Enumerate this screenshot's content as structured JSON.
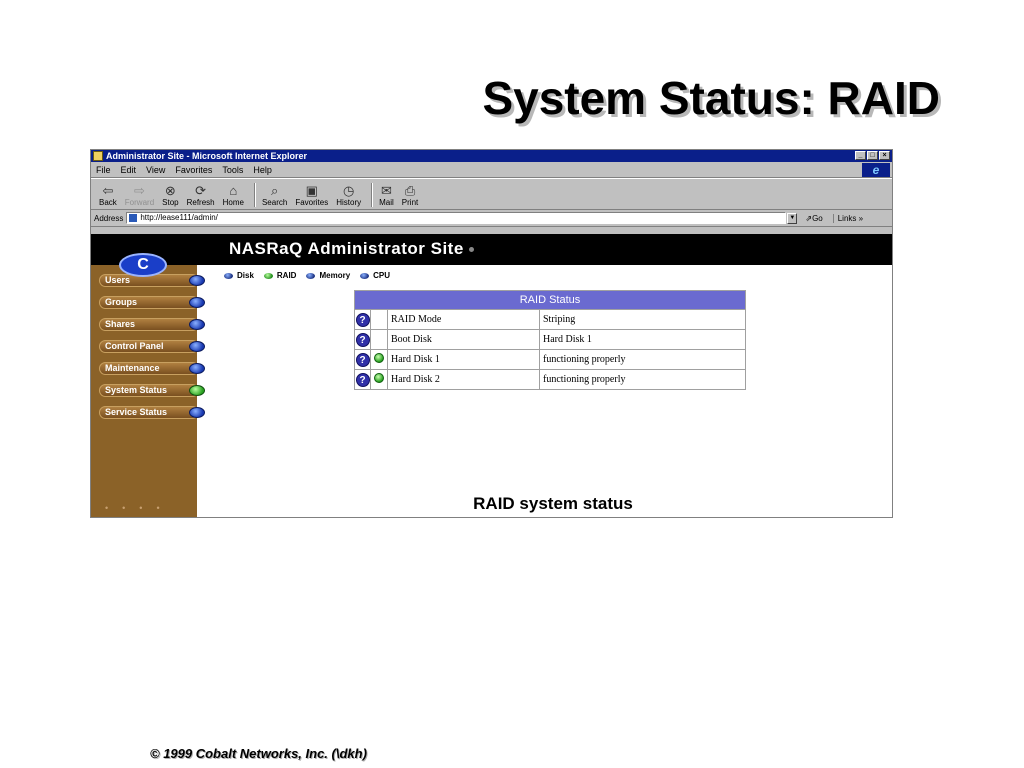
{
  "slide": {
    "title": "System Status: RAID",
    "caption": "RAID system status",
    "footer": "© 1999 Cobalt Networks, Inc. (\\dkh)"
  },
  "browser": {
    "window_title": "Administrator Site - Microsoft Internet Explorer",
    "menu": [
      "File",
      "Edit",
      "View",
      "Favorites",
      "Tools",
      "Help"
    ],
    "toolbar": [
      {
        "label": "Back",
        "icon": "back-arrow-icon",
        "glyph": "⇦"
      },
      {
        "label": "Forward",
        "icon": "forward-arrow-icon",
        "glyph": "⇨"
      },
      {
        "label": "Stop",
        "icon": "stop-icon",
        "glyph": "⊗"
      },
      {
        "label": "Refresh",
        "icon": "refresh-icon",
        "glyph": "⟳"
      },
      {
        "label": "Home",
        "icon": "home-icon",
        "glyph": "⌂"
      },
      {
        "label": "Search",
        "icon": "search-icon",
        "glyph": "⌕"
      },
      {
        "label": "Favorites",
        "icon": "favorites-icon",
        "glyph": "▣"
      },
      {
        "label": "History",
        "icon": "history-icon",
        "glyph": "◷"
      },
      {
        "label": "Mail",
        "icon": "mail-icon",
        "glyph": "✉"
      },
      {
        "label": "Print",
        "icon": "print-icon",
        "glyph": "⎙"
      }
    ],
    "address_label": "Address",
    "address_value": "http://lease111/admin/",
    "go_label": "Go",
    "links_label": "Links »"
  },
  "site": {
    "title": "NASRaQ Administrator Site",
    "logo_letter": "C",
    "subnav": [
      {
        "label": "Disk",
        "led": "blue"
      },
      {
        "label": "RAID",
        "led": "green"
      },
      {
        "label": "Memory",
        "led": "blue"
      },
      {
        "label": "CPU",
        "led": "blue"
      }
    ],
    "sidebar": [
      {
        "label": "Users",
        "led": "blue"
      },
      {
        "label": "Groups",
        "led": "blue"
      },
      {
        "label": "Shares",
        "led": "blue"
      },
      {
        "label": "Control Panel",
        "led": "blue"
      },
      {
        "label": "Maintenance",
        "led": "blue"
      },
      {
        "label": "System Status",
        "led": "green"
      },
      {
        "label": "Service Status",
        "led": "blue"
      }
    ]
  },
  "raid_table": {
    "header": "RAID Status",
    "rows": [
      {
        "name": "RAID Mode",
        "value": "Striping",
        "status_led": false
      },
      {
        "name": "Boot Disk",
        "value": "Hard Disk 1",
        "status_led": false
      },
      {
        "name": "Hard Disk 1",
        "value": "functioning properly",
        "status_led": true
      },
      {
        "name": "Hard Disk 2",
        "value": "functioning properly",
        "status_led": true
      }
    ]
  },
  "colors": {
    "title_bar": "#0a1f8a",
    "sidebar": "#8b6228",
    "table_header": "#6a6ad0",
    "led_blue": "#1838b0",
    "led_green": "#28a020"
  }
}
